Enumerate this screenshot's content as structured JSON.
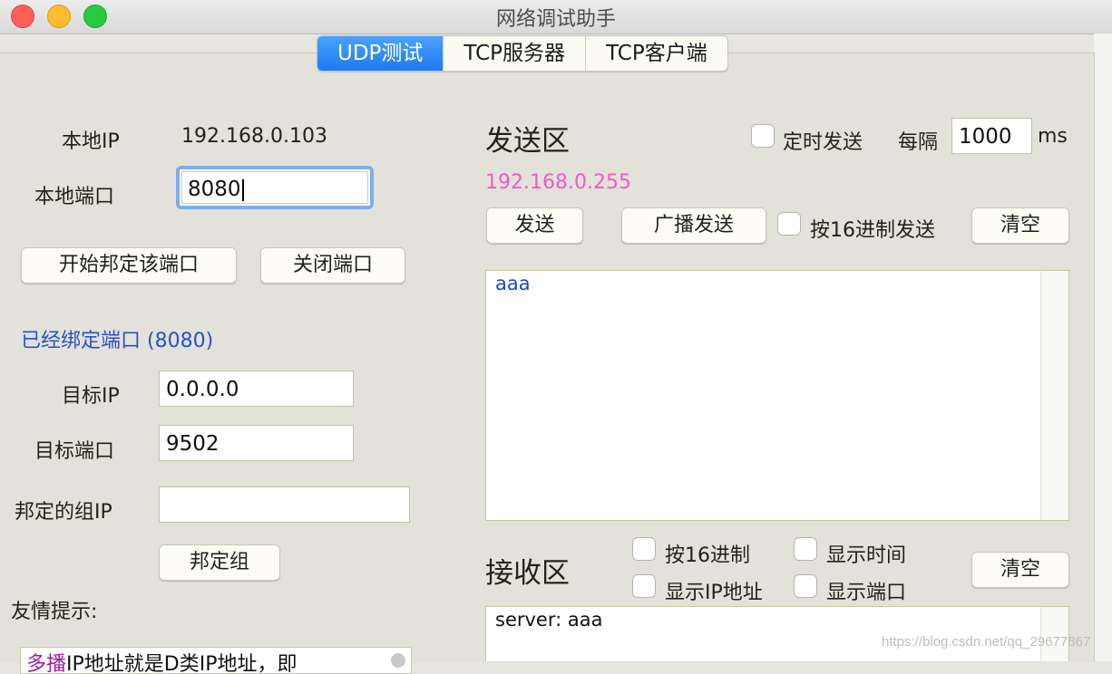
{
  "window": {
    "title": "网络调试助手"
  },
  "tabs": [
    {
      "label": "UDP测试",
      "active": true
    },
    {
      "label": "TCP服务器",
      "active": false
    },
    {
      "label": "TCP客户端",
      "active": false
    }
  ],
  "local": {
    "ip_label": "本地IP",
    "ip_value": "192.168.0.103",
    "port_label": "本地端口",
    "port_value": "8080"
  },
  "buttons": {
    "bind_port": "开始邦定该端口",
    "close_port": "关闭端口",
    "send": "发送",
    "broadcast": "广播发送",
    "clear_send": "清空",
    "bind_group": "邦定组",
    "clear_recv": "清空"
  },
  "status": {
    "bound": "已经绑定端口 (8080)"
  },
  "target": {
    "ip_label": "目标IP",
    "ip_value": "0.0.0.0",
    "port_label": "目标端口",
    "port_value": "9502",
    "group_label": "邦定的组IP",
    "group_value": ""
  },
  "tips": {
    "label": "友情提示:",
    "highlight": "多播",
    "text": "IP地址就是D类IP地址，即"
  },
  "send_area": {
    "title": "发送区",
    "timer_label": "定时发送",
    "interval_label": "每隔",
    "interval_value": "1000",
    "interval_unit": "ms",
    "address": "192.168.0.255",
    "hex_label": "按16进制发送",
    "content": "aaa"
  },
  "recv_area": {
    "title": "接收区",
    "hex_label": "按16进制",
    "show_time_label": "显示时间",
    "show_ip_label": "显示IP地址",
    "show_port_label": "显示端口",
    "content": "server: aaa"
  },
  "watermark": "https://blog.csdn.net/qq_29677867"
}
